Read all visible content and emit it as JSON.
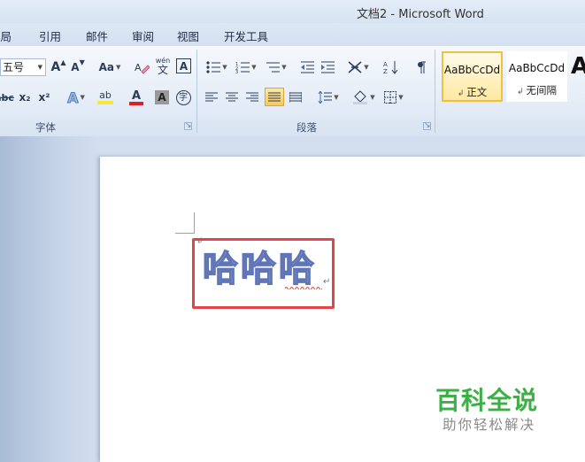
{
  "window": {
    "title": "文档2 - Microsoft Word"
  },
  "menu": {
    "items": [
      "布局",
      "引用",
      "邮件",
      "审阅",
      "视图",
      "开发工具"
    ]
  },
  "ribbon": {
    "font_group": {
      "label": "字体",
      "font_size_value": "五号",
      "grow_font_label": "A",
      "shrink_font_label": "A",
      "change_case_label": "Aa",
      "phonetic_label": "wén",
      "phonetic_char": "文",
      "border_char_label": "A",
      "strikethrough_label": "abc",
      "subscript_label": "x₂",
      "superscript_label": "x²",
      "text_effect_label": "A",
      "highlight_label": "ab",
      "font_color_label": "A",
      "char_shading_label": "A",
      "enclose_char_label": "字",
      "colors": {
        "font_color": "#e02020",
        "highlight_color": "#f7e93b"
      }
    },
    "paragraph_group": {
      "label": "段落"
    },
    "styles": [
      {
        "sample": "AaBbCcDd",
        "name": "正文"
      },
      {
        "sample": "AaBbCcDd",
        "name": "无间隔"
      }
    ],
    "style_third_sample": "A"
  },
  "document": {
    "text": "哈哈哈",
    "highlight_box_color": "#e0454b"
  },
  "watermark": {
    "title": "百科全说",
    "subtitle": "助你轻松解决"
  }
}
